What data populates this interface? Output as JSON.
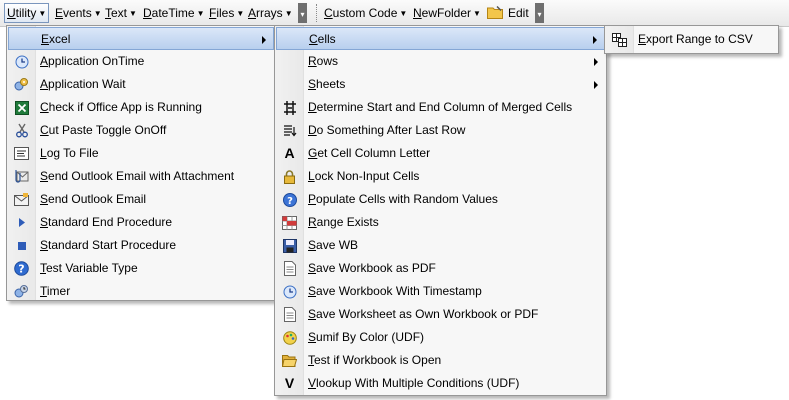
{
  "toolbar": {
    "buttons": [
      {
        "label": "Utility",
        "accel": "U"
      },
      {
        "label": "Events",
        "accel": "E"
      },
      {
        "label": "Text",
        "accel": "T"
      },
      {
        "label": "DateTime",
        "accel": "D"
      },
      {
        "label": "Files",
        "accel": "F"
      },
      {
        "label": "Arrays",
        "accel": "A"
      },
      {
        "label": "Custom Code",
        "accel": "C"
      },
      {
        "label": "NewFolder",
        "accel": "N"
      },
      {
        "label": "Edit"
      }
    ]
  },
  "menu_utility": {
    "items": [
      {
        "label": "Excel",
        "icon": "none"
      },
      {
        "label": "Application OnTime",
        "icon": "clock-icon"
      },
      {
        "label": "Application Wait",
        "icon": "wait-gear-icon"
      },
      {
        "label": "Check if Office App is Running",
        "icon": "excel-icon"
      },
      {
        "label": "Cut Paste Toggle OnOff",
        "icon": "scissors-icon"
      },
      {
        "label": "Log To File",
        "icon": "textbox-icon"
      },
      {
        "label": "Send Outlook Email with Attachment",
        "icon": "outlook-attachment-icon"
      },
      {
        "label": "Send Outlook Email",
        "icon": "envelope-icon"
      },
      {
        "label": "Standard End Procedure",
        "icon": "triangle-right-icon"
      },
      {
        "label": "Standard Start Procedure",
        "icon": "square-icon"
      },
      {
        "label": "Test Variable Type",
        "icon": "help-icon"
      },
      {
        "label": "Timer",
        "icon": "timer-icon"
      }
    ]
  },
  "menu_excel": {
    "items": [
      {
        "label": "Cells",
        "icon": "none"
      },
      {
        "label": "Rows",
        "icon": "none"
      },
      {
        "label": "Sheets",
        "icon": "none"
      },
      {
        "label": "Determine Start and End Column of Merged Cells",
        "icon": "merge-cells-icon"
      },
      {
        "label": "Do Something After Last Row",
        "icon": "last-row-icon"
      },
      {
        "label": "Get Cell Column Letter",
        "icon": "letter-a-icon"
      },
      {
        "label": "Lock Non-Input Cells",
        "icon": "lock-icon"
      },
      {
        "label": "Populate Cells with Random Values",
        "icon": "random-icon"
      },
      {
        "label": "Range Exists",
        "icon": "range-icon"
      },
      {
        "label": "Save WB",
        "icon": "save-icon"
      },
      {
        "label": "Save Workbook as PDF",
        "icon": "document-icon"
      },
      {
        "label": "Save Workbook With Timestamp",
        "icon": "clock-icon"
      },
      {
        "label": "Save Worksheet as Own Workbook or PDF",
        "icon": "document-icon"
      },
      {
        "label": "Sumif By Color (UDF)",
        "icon": "palette-icon"
      },
      {
        "label": "Test if Workbook is Open",
        "icon": "folder-open-icon"
      },
      {
        "label": "Vlookup With Multiple Conditions (UDF)",
        "icon": "letter-v-icon"
      }
    ]
  },
  "menu_cells": {
    "items": [
      {
        "label": "Export Range to CSV",
        "icon": "export-grid-icon"
      }
    ]
  },
  "colors": {
    "highlight": "#b8cfee",
    "highlight_border": "#84a6d5",
    "menu_bg": "#f7f7f7"
  }
}
